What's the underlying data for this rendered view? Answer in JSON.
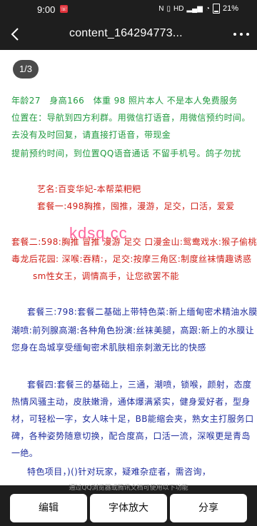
{
  "status_bar": {
    "time": "9:00",
    "notification_badge": "☏",
    "battery_percent": "21%",
    "icons": [
      "nfc-icon",
      "vibrate-icon",
      "hd-icon",
      "signal-icon",
      "wifi-icon",
      "battery-icon"
    ]
  },
  "app_bar": {
    "title": "content_164294773..."
  },
  "document": {
    "page_indicator": "1/3",
    "lines": [
      "年龄27　身高166　体重 98  照片本人  不是本人免费服务",
      "位置在：导航到四方利群。用微信打语音，用微信预约时间。",
      "去没有及时回复，请直接打语音，带现金",
      "提前预约时间，到位置QQ语音通话  不留手机号。鸽子勿扰",
      "艺名:百变华妃-本帮菜粑粑",
      "套餐一:498胸推，囤推，漫游，足交，口活，爱爱",
      "套餐二:598:胸推 冒推 漫游 足交 口漫金山:鸳鸯戏水:猴子偷桃:",
      "毒龙后花园:  深喉:吞精:，足交:按摩三角区:制度丝袜情趣诱惑",
      "sm性女王，调情高手，让您欲罢不能",
      "套餐三:798:套餐二基础上带特色菜:新上缅甸密术精油水膜:",
      "潮喷:前列腺高潮:各种角色扮演:丝袜美腿，高跟:新上的水膜让",
      "您身在岛城享受缅甸密术肌肤相亲刺激无比的快感",
      "套餐四:套餐三的基础上，三通，潮喷，锁喉，颜射，态度",
      "热情风骚主动，皮肤嫩滑，通体爆满紧实，健身爱好者，型身",
      "材，可轻松一字，女人味十足，BB能缩会夹，熟女主打服务口",
      "碑，各种姿势随意切换，配合度高，口活一流，深喉更是青岛",
      "一绝。",
      "特色项目，)()针对玩家，疑难杂症者，需咨询，"
    ],
    "watermark": "kdsq.cc"
  },
  "footer_note": "通过QQ浏览器或腾讯文档可使用以下功能",
  "toolbar": {
    "edit_label": "编辑",
    "zoom_label": "字体放大",
    "share_label": "分享"
  },
  "colors": {
    "green_text": "#1f9a3f",
    "red_text": "#d02018",
    "blue_text": "#1f2d9e",
    "watermark": "#ff4b8c",
    "bar_background": "#1e1e1e"
  }
}
